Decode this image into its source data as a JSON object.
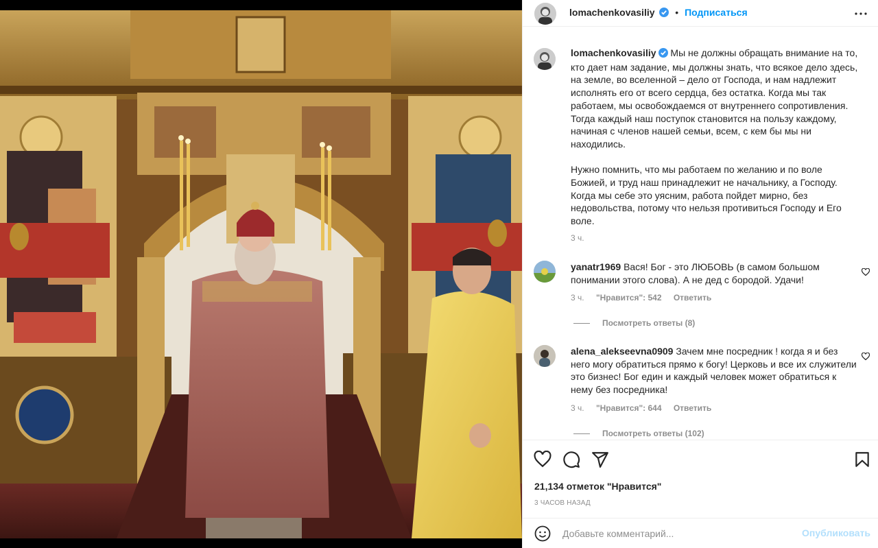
{
  "post": {
    "author": "lomachenkovasiliy",
    "follow_label": "Подписаться",
    "dot": "•",
    "caption": "Мы не должны обращать внимание на то, кто дает нам задание, мы должны знать, что всякое дело здесь, на земле, во вселенной – дело от Господа, и нам надлежит исполнять его от всего сердца, без остатка. Когда мы так работаем, мы освобождаемся от внутреннего сопротивления. Тогда каждый наш поступок становится на пользу каждому, начиная с членов нашей семьи, всем, с кем бы мы ни находились.\n\nНужно помнить, что мы работаем по желанию и по воле Божией, и труд наш принадлежит не начальнику, а Господу. Когда мы себе это уясним, работа пойдет мирно, без недовольства, потому что нельзя противиться Господу и Его воле.",
    "caption_time": "3 ч.",
    "likes_text": "21,134 отметок \"Нравится\"",
    "posted_ago": "3 ЧАСОВ НАЗАД"
  },
  "comments": [
    {
      "username": "yanatr1969",
      "text": "Вася! Бог - это ЛЮБОВЬ (в самом большом понимании этого слова). А не дед с бородой. Удачи!",
      "time": "3 ч.",
      "likes": "\"Нравится\": 542",
      "reply_label": "Ответить",
      "view_replies": "Посмотреть ответы (8)"
    },
    {
      "username": "alena_alekseevna0909",
      "text": "Зачем мне посредник ! когда я и без него могу обратиться прямо к богу! Церковь и все их служители это бизнес! Бог един и каждый человек может обратиться к нему без посредника!",
      "time": "3 ч.",
      "likes": "\"Нравится\": 644",
      "reply_label": "Ответить",
      "view_replies": "Посмотреть ответы (102)"
    }
  ],
  "composer": {
    "placeholder": "Добавьте комментарий...",
    "publish_label": "Опубликовать"
  },
  "icons": {
    "verified": "verified-badge-icon",
    "more": "more-options-icon",
    "like": "heart-icon",
    "comment": "comment-icon",
    "share": "paper-plane-icon",
    "save": "bookmark-icon",
    "emoji": "emoji-icon"
  },
  "colors": {
    "link_blue": "#0095f6",
    "publish_disabled": "#b2dffc",
    "muted": "#8e8e8e"
  }
}
